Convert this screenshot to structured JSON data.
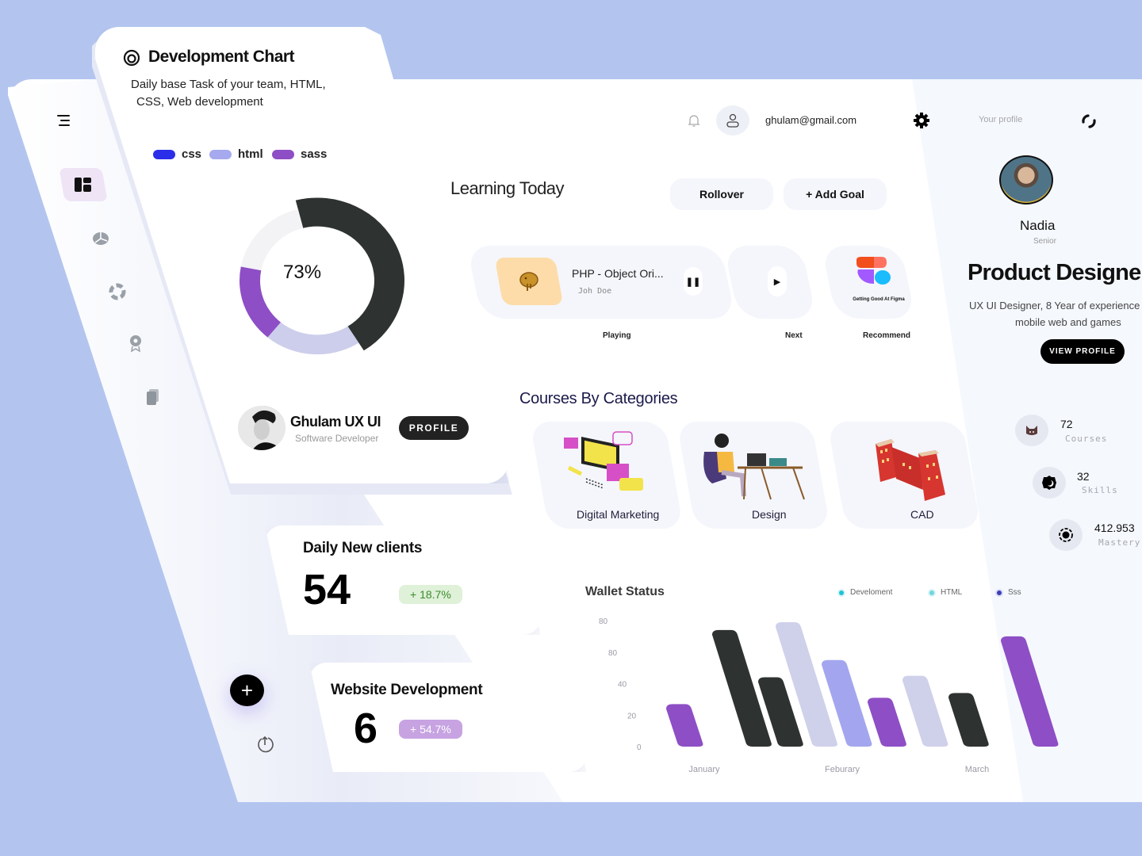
{
  "sidebar": {
    "menu_icon": "menu-icon",
    "items": [
      {
        "name": "dashboard",
        "icon": "grid-icon",
        "active": true
      },
      {
        "name": "analytics",
        "icon": "pie-chart-icon",
        "active": false
      },
      {
        "name": "courses",
        "icon": "lifebuoy-icon",
        "active": false
      },
      {
        "name": "achievements",
        "icon": "badge-icon",
        "active": false
      },
      {
        "name": "documents",
        "icon": "files-icon",
        "active": false
      }
    ],
    "add_label": "+",
    "refresh_icon": "refresh-icon"
  },
  "dev_chart": {
    "title": "Development Chart",
    "subtitle_line1": "Daily base Task of your team, HTML,",
    "subtitle_line2": "CSS, Web development",
    "legend": [
      {
        "label": "css",
        "color": "#2b2ee8"
      },
      {
        "label": "html",
        "color": "#a6a9ee"
      },
      {
        "label": "sass",
        "color": "#8e4ec5"
      }
    ],
    "donut": {
      "center_label": "73%",
      "segments": [
        {
          "name": "dark",
          "value": 45,
          "color": "#2e3230"
        },
        {
          "name": "light",
          "value": 20,
          "color": "#ccceeb"
        },
        {
          "name": "sass",
          "value": 17,
          "color": "#8e4ec5"
        },
        {
          "name": "empty",
          "value": 18,
          "color": "#f3f3f6"
        }
      ]
    },
    "profile": {
      "name": "Ghulam UX UI",
      "role": "Software Developer",
      "button_label": "PROFILE"
    }
  },
  "stats": {
    "clients": {
      "title": "Daily New clients",
      "value": "54",
      "change": "+ 18.7%",
      "badge_bg": "#dff1d8",
      "badge_color": "#3d8a2e"
    },
    "web": {
      "title": "Website Development",
      "value": "6",
      "change": "+ 54.7%",
      "badge_bg": "#c7a3e2",
      "badge_color": "#ffffff"
    }
  },
  "header": {
    "email": "ghulam@gmail.com",
    "your_profile": "Your profile"
  },
  "learning": {
    "title": "Learning Today",
    "rollover_label": "Rollover",
    "add_goal_label": "+ Add Goal",
    "playing": {
      "title": "PHP - Object Ori...",
      "author": "Joh Doe",
      "caption": "Playing"
    },
    "next_caption": "Next",
    "recommend": {
      "text": "Getting Good At Figma",
      "caption": "Recommend"
    }
  },
  "categories": {
    "title": "Courses By Categories",
    "items": [
      {
        "label": "Digital Marketing"
      },
      {
        "label": "Design"
      },
      {
        "label": "CAD"
      }
    ]
  },
  "profile_panel": {
    "name": "Nadia",
    "level": "Senior",
    "headline": "Product Designer",
    "desc_line1": "UX UI Designer, 8 Year of experience",
    "desc_line2": "mobile web and games",
    "button_label": "VIEW PROFILE",
    "stats": [
      {
        "value": "72",
        "label": "Courses",
        "icon": "cat-icon"
      },
      {
        "value": "32",
        "label": "Skills",
        "icon": "moon-badge-icon"
      },
      {
        "value": "412.953",
        "label": "Mastery",
        "icon": "target-gear-icon"
      }
    ]
  },
  "chart_data": {
    "type": "bar",
    "title": "Wallet Status",
    "categories": [
      "January",
      "Feburary",
      "March"
    ],
    "legend": [
      {
        "label": "Develoment",
        "color": "#1fc4d4"
      },
      {
        "label": "HTML",
        "color": "#6fd6dc"
      },
      {
        "label": "Sss",
        "color": "#3a3fb8"
      }
    ],
    "y_ticks": [
      "0",
      "20",
      "40",
      "80",
      "80"
    ],
    "ylim": [
      0,
      80
    ],
    "groups": [
      {
        "category": "January",
        "bars": [
          {
            "value": 27,
            "color": "#8e4ec5"
          },
          {
            "value": 74,
            "color": "#2e3230"
          },
          {
            "value": 44,
            "color": "#2e3230"
          }
        ]
      },
      {
        "category": "Feburary",
        "bars": [
          {
            "value": 79,
            "color": "#cfd0ea"
          },
          {
            "value": 55,
            "color": "#a3a6ee"
          },
          {
            "value": 31,
            "color": "#8e4ec5"
          }
        ]
      },
      {
        "category": "March",
        "bars": [
          {
            "value": 45,
            "color": "#cfd0ea"
          },
          {
            "value": 34,
            "color": "#2e3230"
          },
          {
            "value": 70,
            "color": "#8e4ec5"
          }
        ]
      }
    ],
    "xlabel": "",
    "ylabel": "",
    "grid": false,
    "legend_position": "top-right"
  }
}
